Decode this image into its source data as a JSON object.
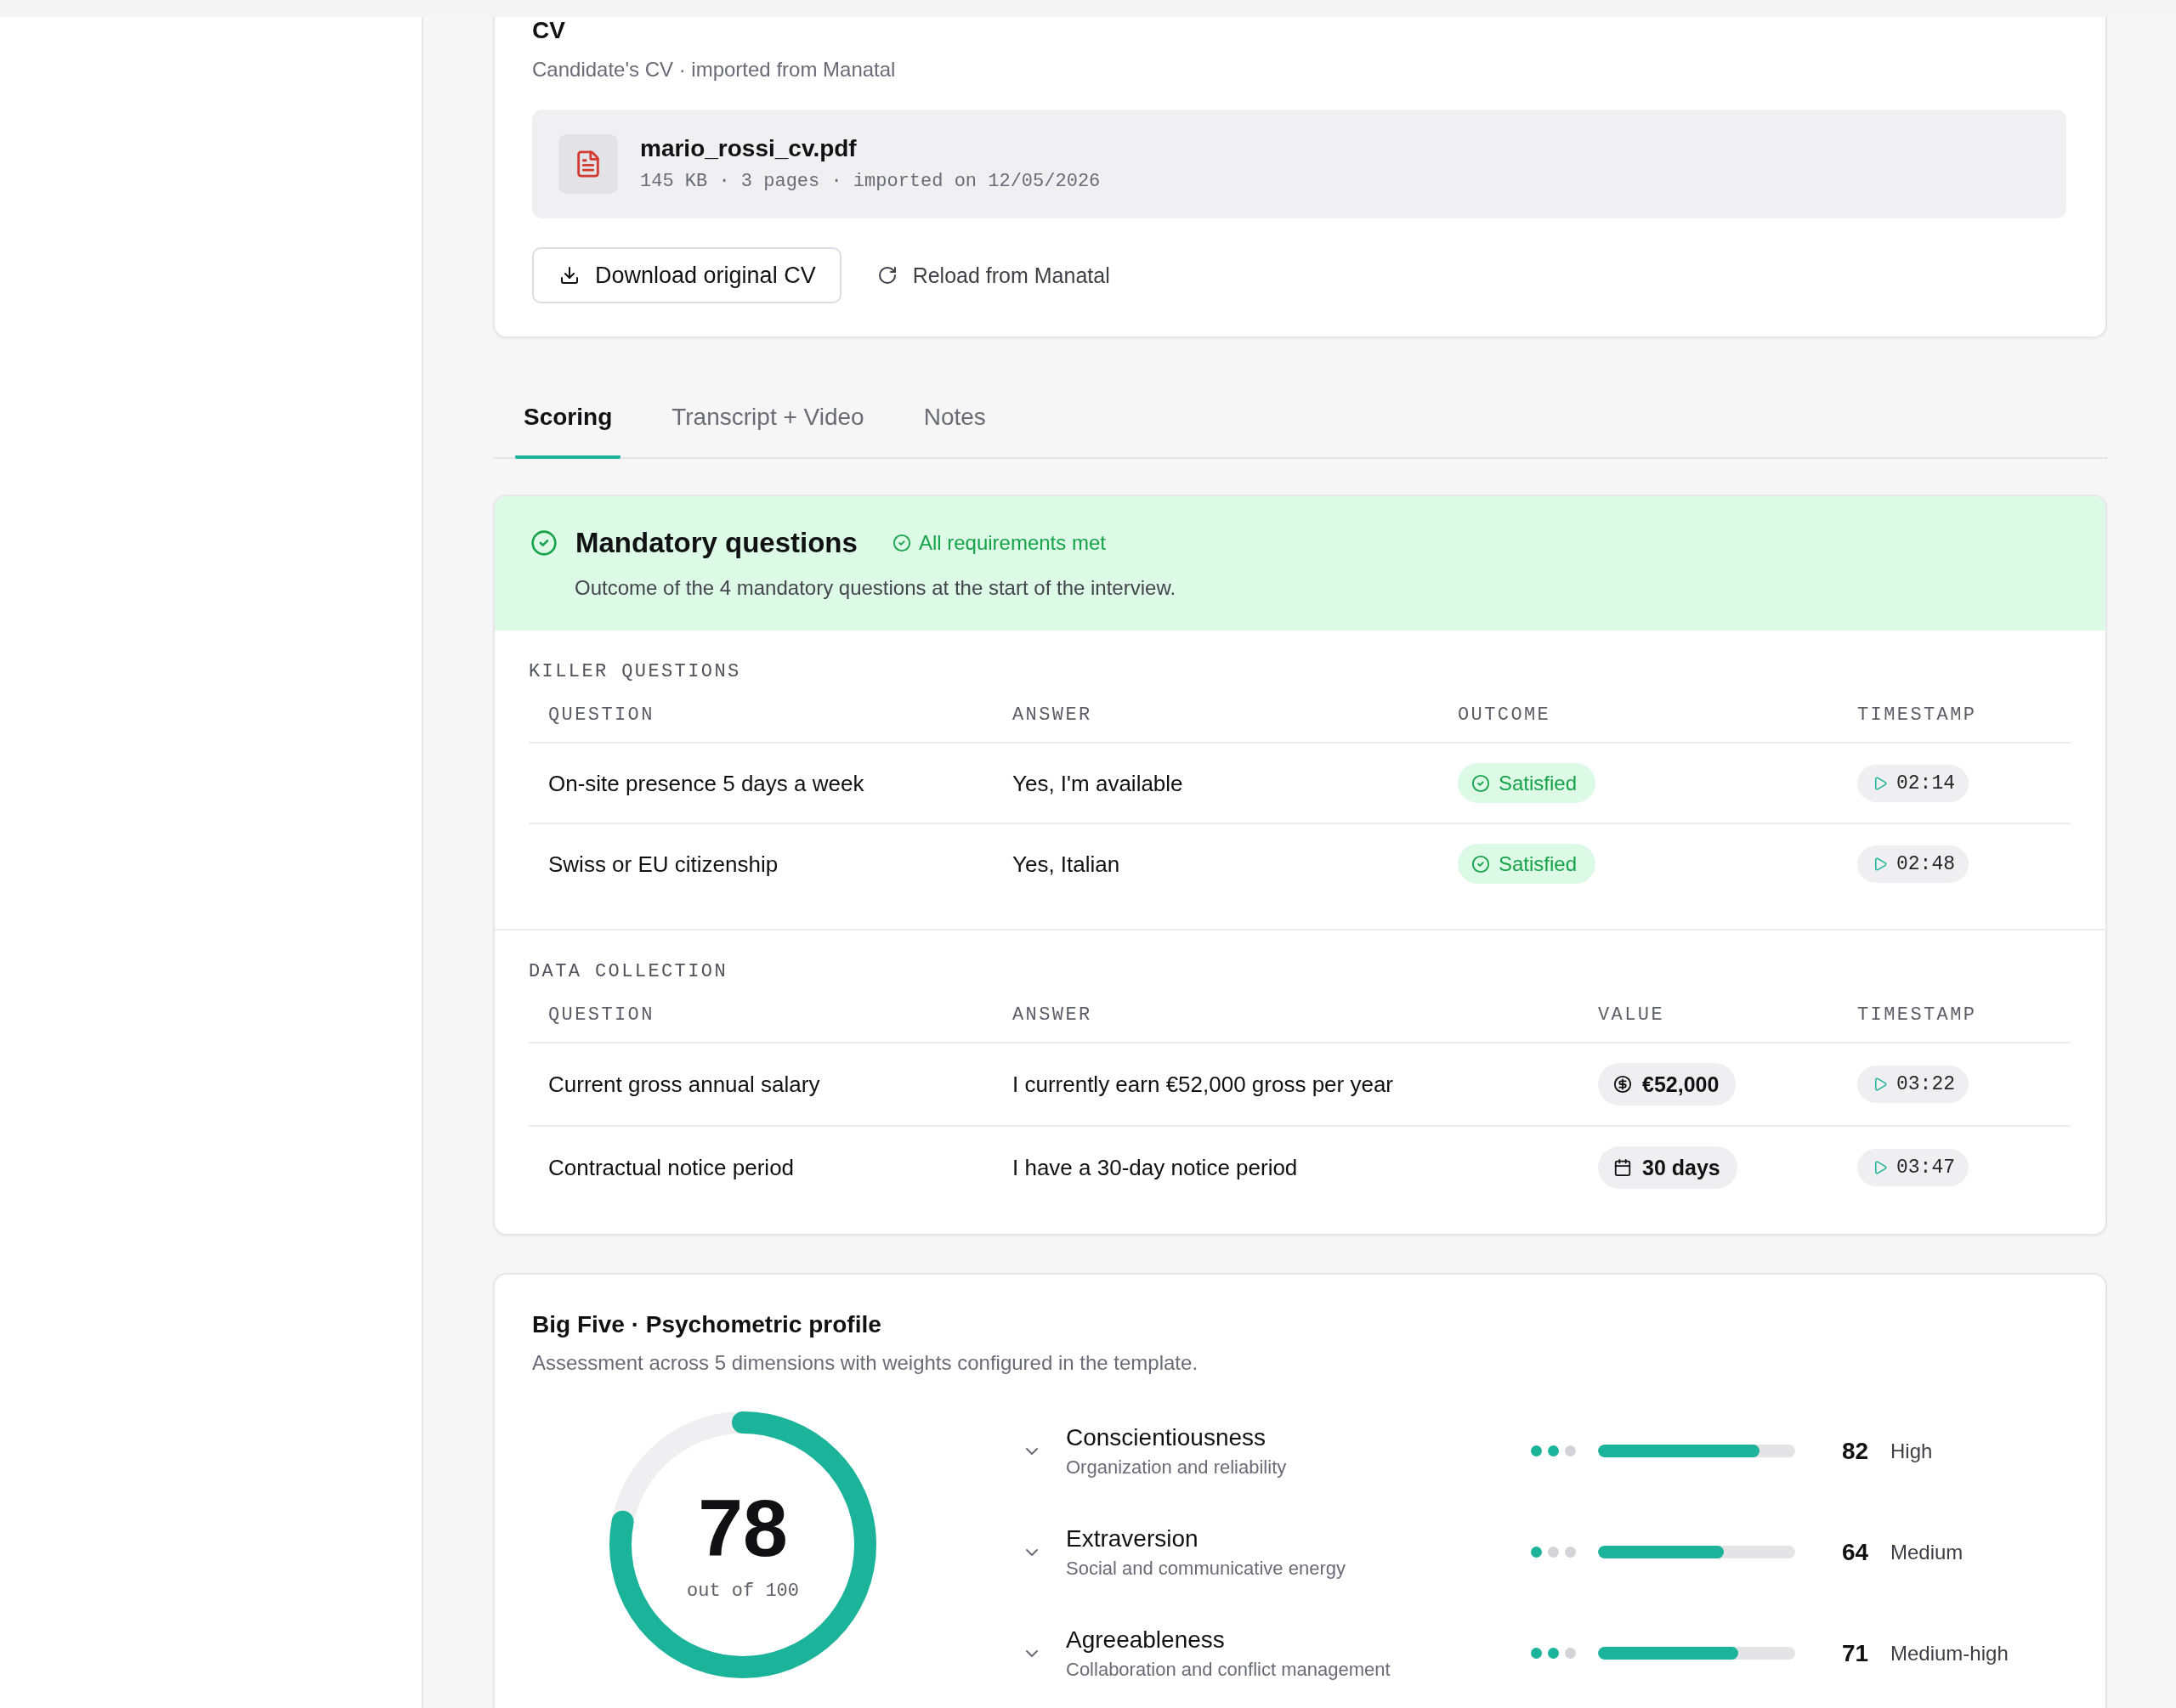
{
  "cv": {
    "title": "CV",
    "subtitle": "Candidate's CV · imported from Manatal",
    "file": {
      "name": "mario_rossi_cv.pdf",
      "meta": "145 KB · 3 pages · imported on 12/05/2026"
    },
    "actions": [
      {
        "label": "Download original CV",
        "kind": "download"
      },
      {
        "label": "Reload from Manatal",
        "kind": "reload"
      }
    ]
  },
  "tabs": [
    {
      "label": "Scoring",
      "selected": true
    },
    {
      "label": "Transcript + Video",
      "selected": false
    },
    {
      "label": "Notes",
      "selected": false
    }
  ],
  "mandatory": {
    "title": "Mandatory questions",
    "status": {
      "text": "All requirements met",
      "met": true
    },
    "description": "Outcome of the 4 mandatory questions at the start of the interview.",
    "sections": [
      {
        "kind": "killer",
        "label": "KILLER QUESTIONS",
        "columns": [
          "QUESTION",
          "ANSWER",
          "OUTCOME",
          "TIMESTAMP"
        ],
        "rows": [
          {
            "question": "On-site presence 5 days a week",
            "answer": "Yes, I'm available",
            "outcome": {
              "text": "Satisfied",
              "satisfied": true
            },
            "timestamp": "02:14"
          },
          {
            "question": "Swiss or EU citizenship",
            "answer": "Yes, Italian",
            "outcome": {
              "text": "Satisfied",
              "satisfied": true
            },
            "timestamp": "02:48"
          }
        ]
      },
      {
        "kind": "data",
        "label": "DATA COLLECTION",
        "columns": [
          "QUESTION",
          "ANSWER",
          "VALUE",
          "TIMESTAMP"
        ],
        "rows": [
          {
            "question": "Current gross annual salary",
            "answer": "I currently earn €52,000 gross per year",
            "value": {
              "text": "€52,000",
              "kind": "currency"
            },
            "timestamp": "03:22"
          },
          {
            "question": "Contractual notice period",
            "answer": "I have a 30-day notice period",
            "value": {
              "text": "30 days",
              "kind": "duration"
            },
            "timestamp": "03:47"
          }
        ]
      }
    ]
  },
  "big_five": {
    "title": "Big Five · Psychometric profile",
    "subtitle": "Assessment across 5 dimensions with weights configured in the template.",
    "score": {
      "value": "78",
      "caption": "out of 100",
      "level": 0.78
    },
    "traits": [
      {
        "name": "Conscientiousness",
        "description": "Organization and reliability",
        "expanded": false,
        "dots": [
          {
            "filled": true
          },
          {
            "filled": true
          },
          {
            "filled": false
          }
        ],
        "level": 0.82,
        "score": "82",
        "rating": "High"
      },
      {
        "name": "Extraversion",
        "description": "Social and communicative energy",
        "expanded": false,
        "dots": [
          {
            "filled": true
          },
          {
            "filled": false
          },
          {
            "filled": false
          }
        ],
        "level": 0.64,
        "score": "64",
        "rating": "Medium"
      },
      {
        "name": "Agreeableness",
        "description": "Collaboration and conflict management",
        "expanded": false,
        "dots": [
          {
            "filled": true
          },
          {
            "filled": true
          },
          {
            "filled": false
          }
        ],
        "level": 0.71,
        "score": "71",
        "rating": "Medium-high"
      }
    ]
  }
}
